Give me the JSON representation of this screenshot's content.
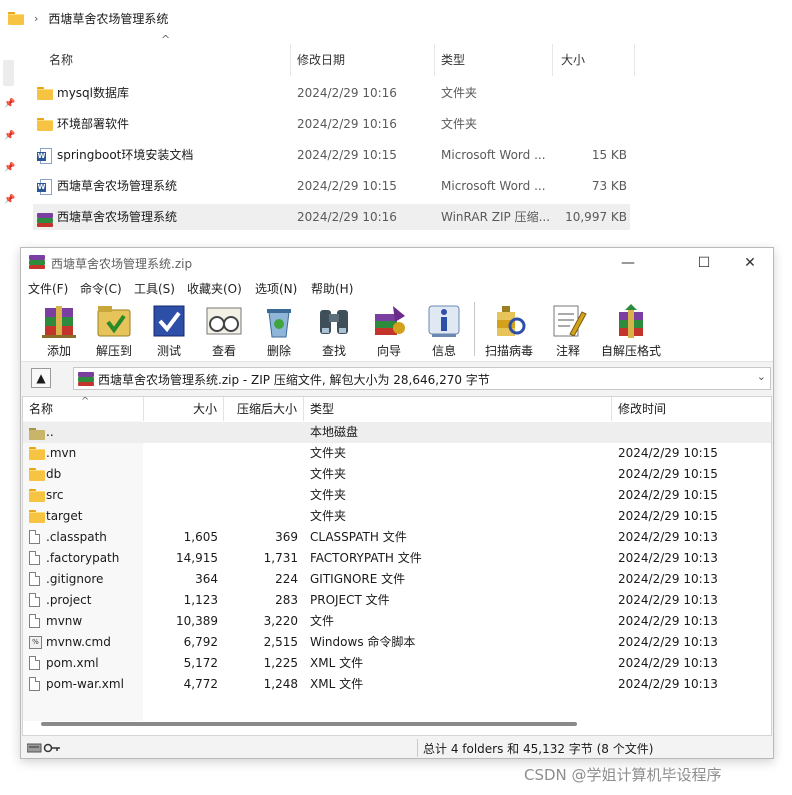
{
  "explorer": {
    "breadcrumb": "西塘草舍农场管理系统",
    "columns": {
      "name": "名称",
      "date": "修改日期",
      "type": "类型",
      "size": "大小"
    },
    "rows": [
      {
        "name": "mysql数据库",
        "date": "2024/2/29 10:16",
        "type": "文件夹",
        "size": "",
        "icon": "folder-icon"
      },
      {
        "name": "环境部署软件",
        "date": "2024/2/29 10:16",
        "type": "文件夹",
        "size": "",
        "icon": "folder-icon"
      },
      {
        "name": "springboot环境安装文档",
        "date": "2024/2/29 10:15",
        "type": "Microsoft Word ...",
        "size": "15 KB",
        "icon": "word-doc-icon"
      },
      {
        "name": "西塘草舍农场管理系统",
        "date": "2024/2/29 10:15",
        "type": "Microsoft Word ...",
        "size": "73 KB",
        "icon": "word-doc-icon"
      },
      {
        "name": "西塘草舍农场管理系统",
        "date": "2024/2/29 10:16",
        "type": "WinRAR ZIP 压缩...",
        "size": "10,997 KB",
        "icon": "winrar-archive-icon",
        "selected": true
      }
    ]
  },
  "winrar": {
    "title": "西塘草舍农场管理系统.zip",
    "window_controls": {
      "minimize": "—",
      "maximize": "☐",
      "close": "✕"
    },
    "menu": [
      "文件(F)",
      "命令(C)",
      "工具(S)",
      "收藏夹(O)",
      "选项(N)",
      "帮助(H)"
    ],
    "toolbar": [
      "添加",
      "解压到",
      "测试",
      "查看",
      "删除",
      "查找",
      "向导",
      "信息",
      "扫描病毒",
      "注释",
      "自解压格式"
    ],
    "path_text": "西塘草舍农场管理系统.zip - ZIP 压缩文件, 解包大小为 28,646,270 字节",
    "columns": {
      "name": "名称",
      "size": "大小",
      "packed": "压缩后大小",
      "type": "类型",
      "modified": "修改时间"
    },
    "rows": [
      {
        "name": "..",
        "size": "",
        "packed": "",
        "type": "本地磁盘",
        "modified": "",
        "kind": "updir"
      },
      {
        "name": ".mvn",
        "size": "",
        "packed": "",
        "type": "文件夹",
        "modified": "2024/2/29 10:15",
        "kind": "folder"
      },
      {
        "name": "db",
        "size": "",
        "packed": "",
        "type": "文件夹",
        "modified": "2024/2/29 10:15",
        "kind": "folder"
      },
      {
        "name": "src",
        "size": "",
        "packed": "",
        "type": "文件夹",
        "modified": "2024/2/29 10:15",
        "kind": "folder"
      },
      {
        "name": "target",
        "size": "",
        "packed": "",
        "type": "文件夹",
        "modified": "2024/2/29 10:15",
        "kind": "folder"
      },
      {
        "name": ".classpath",
        "size": "1,605",
        "packed": "369",
        "type": "CLASSPATH 文件",
        "modified": "2024/2/29 10:13",
        "kind": "file"
      },
      {
        "name": ".factorypath",
        "size": "14,915",
        "packed": "1,731",
        "type": "FACTORYPATH 文件",
        "modified": "2024/2/29 10:13",
        "kind": "file"
      },
      {
        "name": ".gitignore",
        "size": "364",
        "packed": "224",
        "type": "GITIGNORE 文件",
        "modified": "2024/2/29 10:13",
        "kind": "file"
      },
      {
        "name": ".project",
        "size": "1,123",
        "packed": "283",
        "type": "PROJECT 文件",
        "modified": "2024/2/29 10:13",
        "kind": "file"
      },
      {
        "name": "mvnw",
        "size": "10,389",
        "packed": "3,220",
        "type": "文件",
        "modified": "2024/2/29 10:13",
        "kind": "file"
      },
      {
        "name": "mvnw.cmd",
        "size": "6,792",
        "packed": "2,515",
        "type": "Windows 命令脚本",
        "modified": "2024/2/29 10:13",
        "kind": "cmd"
      },
      {
        "name": "pom.xml",
        "size": "5,172",
        "packed": "1,225",
        "type": "XML 文件",
        "modified": "2024/2/29 10:13",
        "kind": "file"
      },
      {
        "name": "pom-war.xml",
        "size": "4,772",
        "packed": "1,248",
        "type": "XML 文件",
        "modified": "2024/2/29 10:13",
        "kind": "file"
      }
    ],
    "status": "总计 4 folders 和 45,132 字节 (8 个文件)"
  },
  "watermark": "CSDN @学姐计算机毕设程序"
}
